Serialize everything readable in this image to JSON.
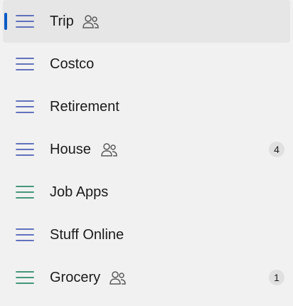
{
  "lists": [
    {
      "name": "Trip",
      "shared": true,
      "count": "",
      "selected": true,
      "icon_color": "#4f5fb5"
    },
    {
      "name": "Costco",
      "shared": false,
      "count": "",
      "selected": false,
      "icon_color": "#4f5fb5"
    },
    {
      "name": "Retirement",
      "shared": false,
      "count": "",
      "selected": false,
      "icon_color": "#4f5fb5"
    },
    {
      "name": "House",
      "shared": true,
      "count": "4",
      "selected": false,
      "icon_color": "#4f5fb5"
    },
    {
      "name": "Job Apps",
      "shared": false,
      "count": "",
      "selected": false,
      "icon_color": "#2b8a6a"
    },
    {
      "name": "Stuff Online",
      "shared": false,
      "count": "",
      "selected": false,
      "icon_color": "#4f5fb5"
    },
    {
      "name": "Grocery",
      "shared": true,
      "count": "1",
      "selected": false,
      "icon_color": "#2b8a6a"
    }
  ],
  "icons": {
    "list_icon": "hamburger-list-icon",
    "shared_icon": "people-shared-icon"
  },
  "colors": {
    "selected_indicator": "#0a5bc4",
    "selected_background": "#e6e6e6",
    "badge_background": "#e0e0e0",
    "shared_icon_stroke": "#5a5a5a"
  }
}
